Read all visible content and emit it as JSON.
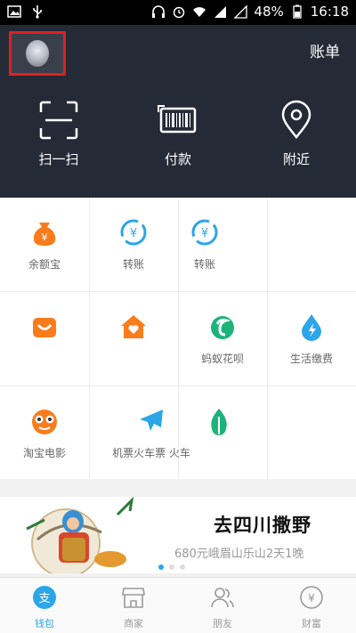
{
  "status_bar": {
    "battery_percent": "48%",
    "time": "16:18",
    "icons": [
      "image-icon",
      "usb-icon",
      "headphones-icon",
      "alarm-icon",
      "wifi-icon",
      "signal-icon",
      "battery-icon"
    ]
  },
  "header": {
    "bill_label": "账单",
    "actions": [
      {
        "label": "扫一扫",
        "icon": "scan-icon"
      },
      {
        "label": "付款",
        "icon": "barcode-pay-icon"
      },
      {
        "label": "附近",
        "icon": "location-pin-icon"
      }
    ]
  },
  "grid": {
    "items": [
      {
        "label": "余额宝",
        "icon": "money-bag-icon",
        "color": "#f97c1c"
      },
      {
        "label": "转账",
        "icon": "transfer-icon",
        "color": "#2ba6e8"
      },
      {
        "label": "转账",
        "icon": "transfer-icon",
        "color": "#2ba6e8"
      },
      {
        "label": "",
        "icon": "",
        "color": ""
      },
      {
        "label": "",
        "icon": "smile-icon",
        "color": "#f97c1c"
      },
      {
        "label": "",
        "icon": "home-heart-icon",
        "color": "#f97c1c"
      },
      {
        "label": "蚂蚁花呗",
        "icon": "huabei-icon",
        "color": "#1db37a"
      },
      {
        "label": "生活缴费",
        "icon": "water-drop-icon",
        "color": "#2ba6e8"
      },
      {
        "label": "淘宝电影",
        "icon": "glasses-face-icon",
        "color": "#f97c1c"
      },
      {
        "label": "机票火车票 火车",
        "icon": "airplane-icon",
        "color": "#2ba6e8"
      },
      {
        "label": "",
        "icon": "leaf-icon",
        "color": "#1db37a"
      },
      {
        "label": "",
        "icon": "",
        "color": ""
      }
    ]
  },
  "banner": {
    "title": "去四川撒野",
    "subtitle": "680元峨眉山乐山2天1晚",
    "dots": 3,
    "active_dot": 0
  },
  "tabbar": {
    "tabs": [
      {
        "label": "钱包",
        "icon": "wallet-icon",
        "active": true
      },
      {
        "label": "商家",
        "icon": "store-icon",
        "active": false
      },
      {
        "label": "朋友",
        "icon": "friends-icon",
        "active": false
      },
      {
        "label": "财富",
        "icon": "wealth-icon",
        "active": false
      }
    ]
  },
  "colors": {
    "header_bg": "#252a37",
    "accent_blue": "#2ba6e8",
    "accent_orange": "#f97c1c",
    "accent_green": "#1db37a",
    "avatar_border": "#e02020"
  }
}
